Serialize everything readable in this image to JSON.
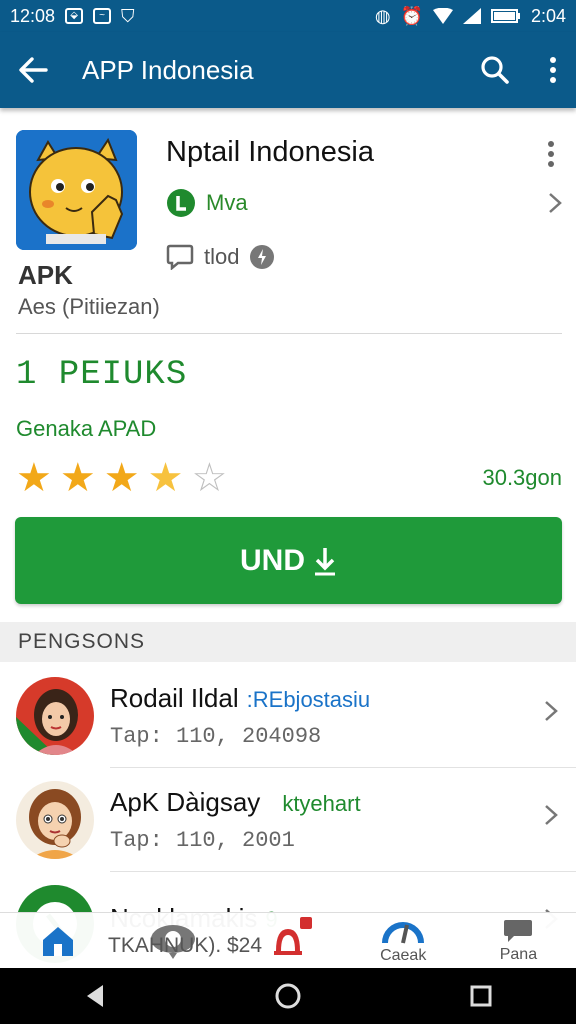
{
  "status_bar": {
    "time_left": "12:08",
    "time_right": "2:04"
  },
  "app_bar": {
    "title": "APP Indonesia"
  },
  "app": {
    "name": "Nptail Indonesia",
    "developer": "Mva",
    "meta": "tlod",
    "label": "APK",
    "sublabel": "Aes (Pitiiezan)"
  },
  "stats": {
    "downloads": "1 PEIUKS",
    "genre": "Genaka APAD",
    "rating": 3.5,
    "rating_count": "30.3gon"
  },
  "install": {
    "label": "UND"
  },
  "section": {
    "title": "PENGSONS"
  },
  "list": [
    {
      "title": "Rodail Ildal",
      "tag": ":REbjostasiu",
      "tag_color": "#1a73c8",
      "subtitle": "Tap: 110, 204098"
    },
    {
      "title": "ApK Dàigsay",
      "tag": "ktyehart",
      "tag_color": "#1f8a2e",
      "subtitle": "Tap: 110, 2001"
    },
    {
      "title": "Ncoklamakis",
      "tag": "9",
      "tag_color": "#1f8a2e",
      "subtitle": ""
    }
  ],
  "price": "TKAHNUK). $24",
  "bottom_nav": [
    {
      "label": "",
      "icon": "home-icon"
    },
    {
      "label": "",
      "icon": "chat-icon"
    },
    {
      "label": "",
      "icon": "bell-icon"
    },
    {
      "label": "Caeak",
      "icon": "gauge-icon"
    },
    {
      "label": "Pana",
      "icon": "chat-bubble-icon"
    }
  ],
  "colors": {
    "primary": "#0b5a8a",
    "accent": "#1f9a3a",
    "star": "#f2a819"
  }
}
